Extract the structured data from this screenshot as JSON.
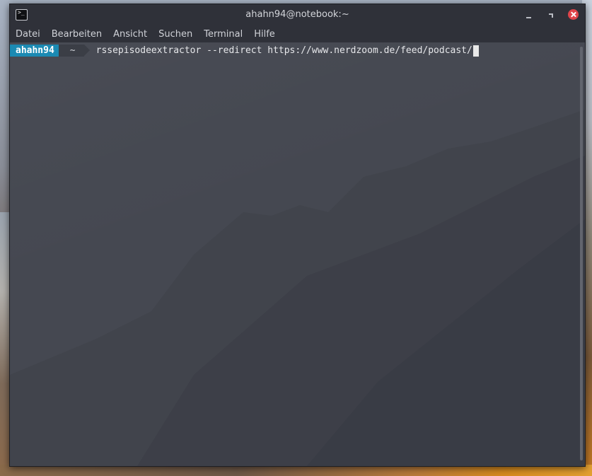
{
  "window": {
    "title": "ahahn94@notebook:~",
    "app_icon": "terminal-icon",
    "controls": [
      "minimize-icon",
      "maximize-icon",
      "close-icon"
    ],
    "close_color": "#e0444a"
  },
  "menubar": {
    "items": [
      {
        "label": "Datei"
      },
      {
        "label": "Bearbeiten"
      },
      {
        "label": "Ansicht"
      },
      {
        "label": "Suchen"
      },
      {
        "label": "Terminal"
      },
      {
        "label": "Hilfe"
      }
    ]
  },
  "terminal": {
    "prompt_user": "ahahn94",
    "prompt_dir": "~",
    "command": "rssepisodeextractor --redirect https://www.nerdzoom.de/feed/podcast/",
    "prompt_user_color": "#1b8ab3",
    "background_color": "#454851"
  }
}
